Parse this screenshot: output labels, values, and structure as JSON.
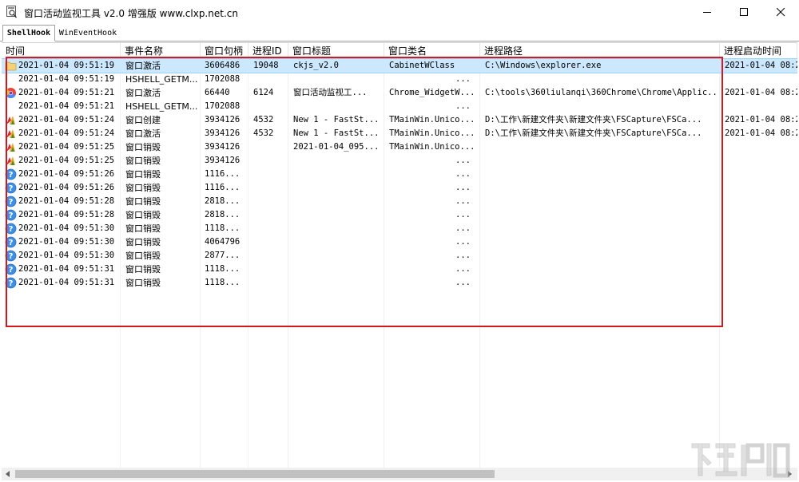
{
  "window": {
    "title": "窗口活动监视工具 v2.0 增强版 www.clxp.net.cn",
    "icon": "magnifier-window-icon"
  },
  "tabs": [
    {
      "label": "ShellHook",
      "active": true
    },
    {
      "label": "WinEventHook",
      "active": false
    }
  ],
  "table": {
    "columns": [
      "时间",
      "事件名称",
      "窗口句柄",
      "进程ID",
      "窗口标题",
      "窗口类名",
      "进程路径",
      "进程启动时间"
    ],
    "rows": [
      {
        "icon": "folder",
        "time": "2021-01-04 09:51:19",
        "event": "窗口激活",
        "handle": "3606486",
        "pid": "19048",
        "title": "ckjs_v2.0",
        "class": "CabinetWClass",
        "path": "C:\\Windows\\explorer.exe",
        "start": "2021-01-04 08:2",
        "selected": true
      },
      {
        "icon": "none",
        "time": "2021-01-04 09:51:19",
        "event": "HSHELL_GETM...",
        "handle": "1702088",
        "pid": "",
        "title": "",
        "class": "...",
        "path": "",
        "start": ""
      },
      {
        "icon": "chrome",
        "time": "2021-01-04 09:51:21",
        "event": "窗口激活",
        "handle": "66440",
        "pid": "6124",
        "title": "窗口活动监视工...",
        "class": "Chrome_WidgetW...",
        "path": "C:\\tools\\360liulanqi\\360Chrome\\Chrome\\Applic...",
        "start": "2021-01-04 08:2"
      },
      {
        "icon": "none",
        "time": "2021-01-04 09:51:21",
        "event": "HSHELL_GETM...",
        "handle": "1702088",
        "pid": "",
        "title": "",
        "class": "...",
        "path": "",
        "start": ""
      },
      {
        "icon": "capture",
        "time": "2021-01-04 09:51:24",
        "event": "窗口创建",
        "handle": "3934126",
        "pid": "4532",
        "title": "New 1 - FastSt...",
        "class": "TMainWin.Unico...",
        "path": "D:\\工作\\新建文件夹\\新建文件夹\\FSCapture\\FSCa...",
        "start": "2021-01-04 08:2"
      },
      {
        "icon": "capture",
        "time": "2021-01-04 09:51:24",
        "event": "窗口激活",
        "handle": "3934126",
        "pid": "4532",
        "title": "New 1 - FastSt...",
        "class": "TMainWin.Unico...",
        "path": "D:\\工作\\新建文件夹\\新建文件夹\\FSCapture\\FSCa...",
        "start": "2021-01-04 08:2"
      },
      {
        "icon": "capture",
        "time": "2021-01-04 09:51:25",
        "event": "窗口销毁",
        "handle": "3934126",
        "pid": "",
        "title": "2021-01-04_095...",
        "class": "TMainWin.Unico...",
        "path": "",
        "start": ""
      },
      {
        "icon": "capture",
        "time": "2021-01-04 09:51:25",
        "event": "窗口销毁",
        "handle": "3934126",
        "pid": "",
        "title": "",
        "class": "...",
        "path": "",
        "start": ""
      },
      {
        "icon": "help",
        "time": "2021-01-04 09:51:26",
        "event": "窗口销毁",
        "handle": "1116...",
        "pid": "",
        "title": "",
        "class": "...",
        "path": "",
        "start": ""
      },
      {
        "icon": "help",
        "time": "2021-01-04 09:51:26",
        "event": "窗口销毁",
        "handle": "1116...",
        "pid": "",
        "title": "",
        "class": "...",
        "path": "",
        "start": ""
      },
      {
        "icon": "help",
        "time": "2021-01-04 09:51:28",
        "event": "窗口销毁",
        "handle": "2818...",
        "pid": "",
        "title": "",
        "class": "...",
        "path": "",
        "start": ""
      },
      {
        "icon": "help",
        "time": "2021-01-04 09:51:28",
        "event": "窗口销毁",
        "handle": "2818...",
        "pid": "",
        "title": "",
        "class": "...",
        "path": "",
        "start": ""
      },
      {
        "icon": "help",
        "time": "2021-01-04 09:51:30",
        "event": "窗口销毁",
        "handle": "1118...",
        "pid": "",
        "title": "",
        "class": "...",
        "path": "",
        "start": ""
      },
      {
        "icon": "help",
        "time": "2021-01-04 09:51:30",
        "event": "窗口销毁",
        "handle": "4064796",
        "pid": "",
        "title": "",
        "class": "...",
        "path": "",
        "start": ""
      },
      {
        "icon": "help",
        "time": "2021-01-04 09:51:30",
        "event": "窗口销毁",
        "handle": "2877...",
        "pid": "",
        "title": "",
        "class": "...",
        "path": "",
        "start": ""
      },
      {
        "icon": "help",
        "time": "2021-01-04 09:51:31",
        "event": "窗口销毁",
        "handle": "1118...",
        "pid": "",
        "title": "",
        "class": "...",
        "path": "",
        "start": ""
      },
      {
        "icon": "help",
        "time": "2021-01-04 09:51:31",
        "event": "窗口销毁",
        "handle": "1118...",
        "pid": "",
        "title": "",
        "class": "...",
        "path": "",
        "start": ""
      }
    ]
  },
  "annotation": {
    "highlight_color": "#d4191e"
  },
  "colors": {
    "selection": "#cce8ff",
    "scrollbar_thumb": "#c1c1c1"
  }
}
